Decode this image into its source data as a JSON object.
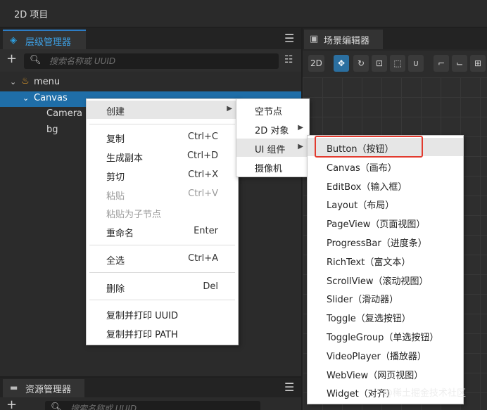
{
  "app": {
    "title": "2D 项目"
  },
  "hierarchy": {
    "tab_label": "层级管理器",
    "search_placeholder": "搜索名称或 UUID",
    "tree": [
      {
        "label": "menu",
        "depth": 0,
        "expanded": true,
        "selected": false
      },
      {
        "label": "Canvas",
        "depth": 1,
        "expanded": true,
        "selected": true
      },
      {
        "label": "Camera",
        "depth": 2,
        "selected": false
      },
      {
        "label": "bg",
        "depth": 2,
        "selected": false
      }
    ]
  },
  "assets": {
    "tab_label": "资源管理器",
    "search_placeholder": "搜索名称或 UUID"
  },
  "scene": {
    "tab_label": "场景编辑器",
    "toolbar": [
      "2D",
      "move",
      "rotate",
      "scale",
      "rect",
      "transform",
      "snap",
      "pivot"
    ]
  },
  "context_menu": {
    "items": [
      {
        "label": "创建",
        "shortcut": "",
        "submenu": true
      },
      {
        "label": "复制",
        "shortcut": "Ctrl+C"
      },
      {
        "label": "生成副本",
        "shortcut": "Ctrl+D"
      },
      {
        "label": "剪切",
        "shortcut": "Ctrl+X"
      },
      {
        "label": "粘贴",
        "shortcut": "Ctrl+V",
        "disabled": true
      },
      {
        "label": "粘贴为子节点",
        "shortcut": "",
        "disabled": true
      },
      {
        "label": "重命名",
        "shortcut": "Enter"
      },
      {
        "label": "全选",
        "shortcut": "Ctrl+A"
      },
      {
        "label": "删除",
        "shortcut": "Del"
      },
      {
        "label": "复制并打印 UUID",
        "shortcut": ""
      },
      {
        "label": "复制并打印 PATH",
        "shortcut": ""
      }
    ]
  },
  "create_submenu": {
    "items": [
      {
        "label": "空节点"
      },
      {
        "label": "2D 对象",
        "submenu": true
      },
      {
        "label": "UI 组件",
        "submenu": true
      },
      {
        "label": "摄像机"
      }
    ]
  },
  "ui_submenu": {
    "items": [
      {
        "label": "Button（按钮）"
      },
      {
        "label": "Canvas（画布）"
      },
      {
        "label": "EditBox（输入框）"
      },
      {
        "label": "Layout（布局）"
      },
      {
        "label": "PageView（页面视图）"
      },
      {
        "label": "ProgressBar（进度条）"
      },
      {
        "label": "RichText（富文本）"
      },
      {
        "label": "ScrollView（滚动视图）"
      },
      {
        "label": "Slider（滑动器）"
      },
      {
        "label": "Toggle（复选按钮）"
      },
      {
        "label": "ToggleGroup（单选按钮）"
      },
      {
        "label": "VideoPlayer（播放器）"
      },
      {
        "label": "WebView（网页视图）"
      },
      {
        "label": "Widget（对齐）"
      }
    ]
  },
  "watermark": "@稀土掘金技术社区",
  "colors": {
    "accent": "#2d7dc5",
    "selection": "#1f6ea8",
    "highlight_border": "#e23a2e"
  }
}
